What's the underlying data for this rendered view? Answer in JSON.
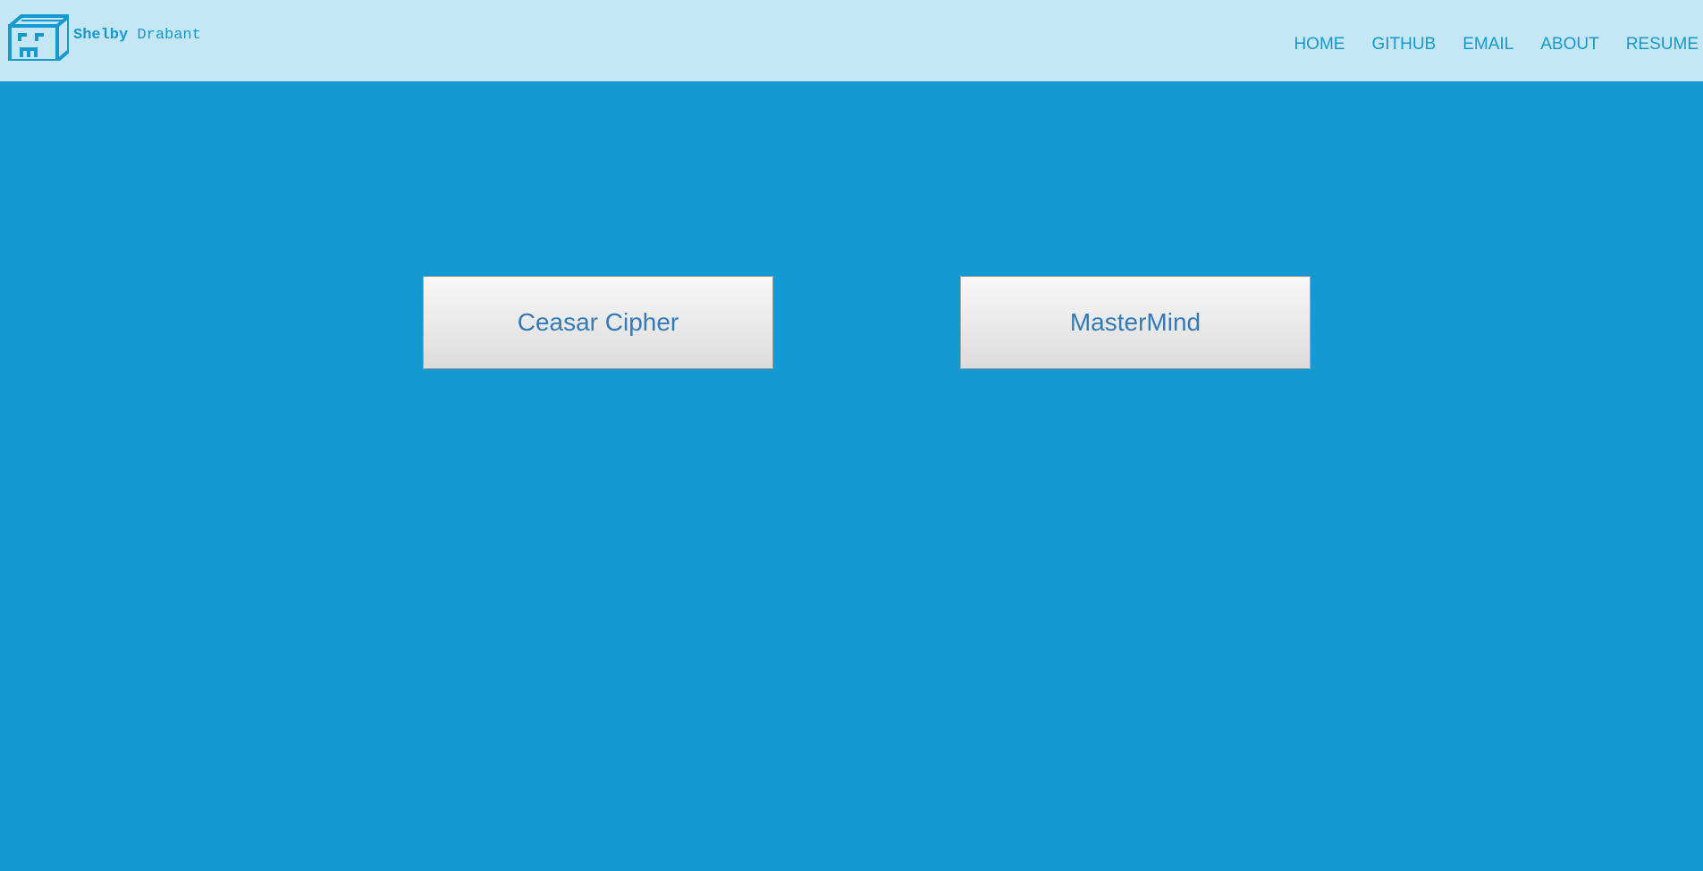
{
  "brand": {
    "first_name": "Shelby",
    "last_name": "Drabant",
    "logo_icon": "cube-face-logo-icon"
  },
  "nav": {
    "items": [
      {
        "label": "HOME"
      },
      {
        "label": "GITHUB"
      },
      {
        "label": "EMAIL"
      },
      {
        "label": "ABOUT"
      },
      {
        "label": "RESUME"
      }
    ]
  },
  "projects": [
    {
      "label": "Ceasar Cipher"
    },
    {
      "label": "MasterMind"
    }
  ],
  "colors": {
    "page_background": "#1499d1",
    "header_background": "#c5e7f5",
    "accent": "#1499d1",
    "button_text": "#337ab7"
  }
}
